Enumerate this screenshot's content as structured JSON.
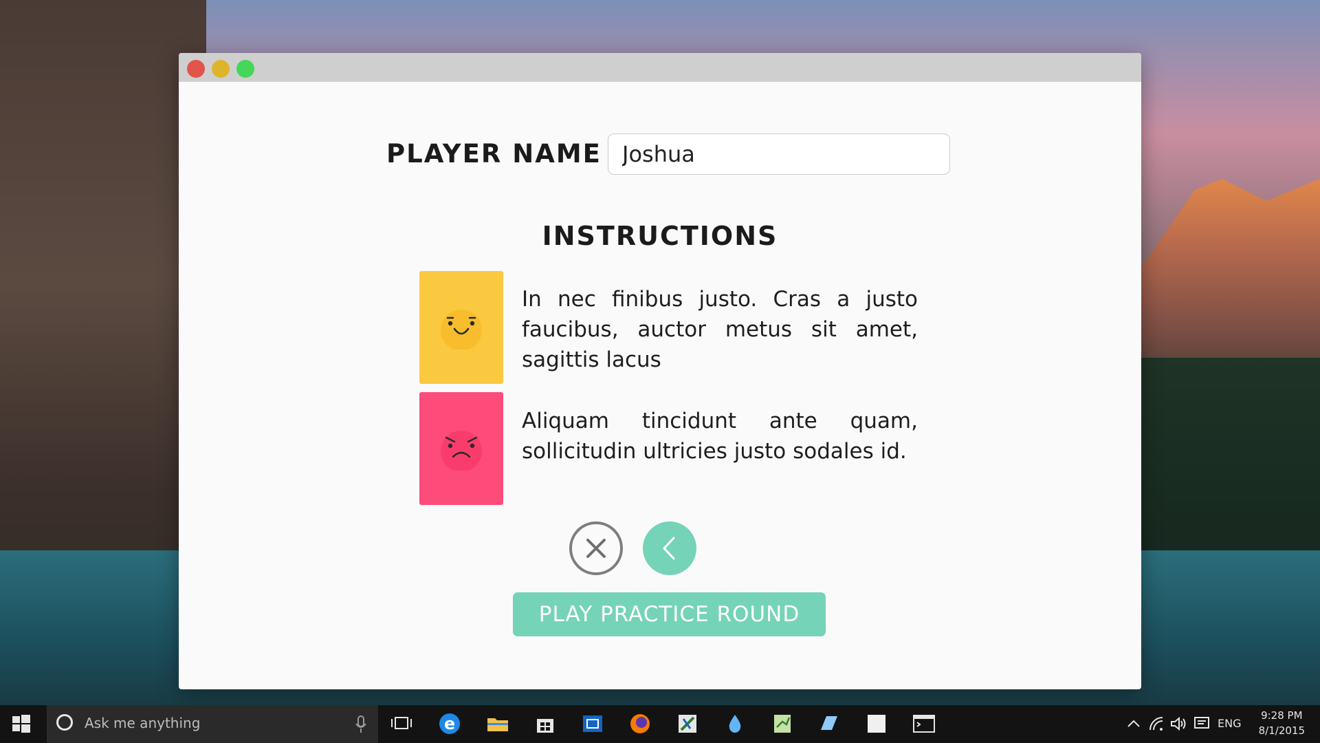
{
  "window": {
    "player_name_label": "Player Name",
    "player_name_value": "Joshua",
    "instructions_title": "Instructions",
    "instructions": [
      {
        "card": "happy",
        "text": "In nec finibus justo. Cras a justo faucibus, auctor metus sit amet, sagittis lacus"
      },
      {
        "card": "angry",
        "text": "Aliquam tincidunt ante quam, sollicitudin ultricies justo sodales id."
      }
    ],
    "play_button_label": "PLAY PRACTICE ROUND"
  },
  "colors": {
    "happy_card": "#fbc93f",
    "angry_card": "#fd4b7a",
    "accent": "#75d3b7",
    "traffic_red": "#e2554b",
    "traffic_yellow": "#dfb42d",
    "traffic_green": "#45d65a"
  },
  "taskbar": {
    "search_placeholder": "Ask me anything",
    "pinned_icons": [
      "task-view-icon",
      "edge-icon",
      "file-explorer-icon",
      "store-icon",
      "app-icon",
      "firefox-icon",
      "app-icon",
      "droplet-icon",
      "notepad-icon",
      "app-icon",
      "app-icon",
      "terminal-icon"
    ],
    "language": "ENG",
    "time": "9:28 PM",
    "date": "8/1/2015"
  }
}
